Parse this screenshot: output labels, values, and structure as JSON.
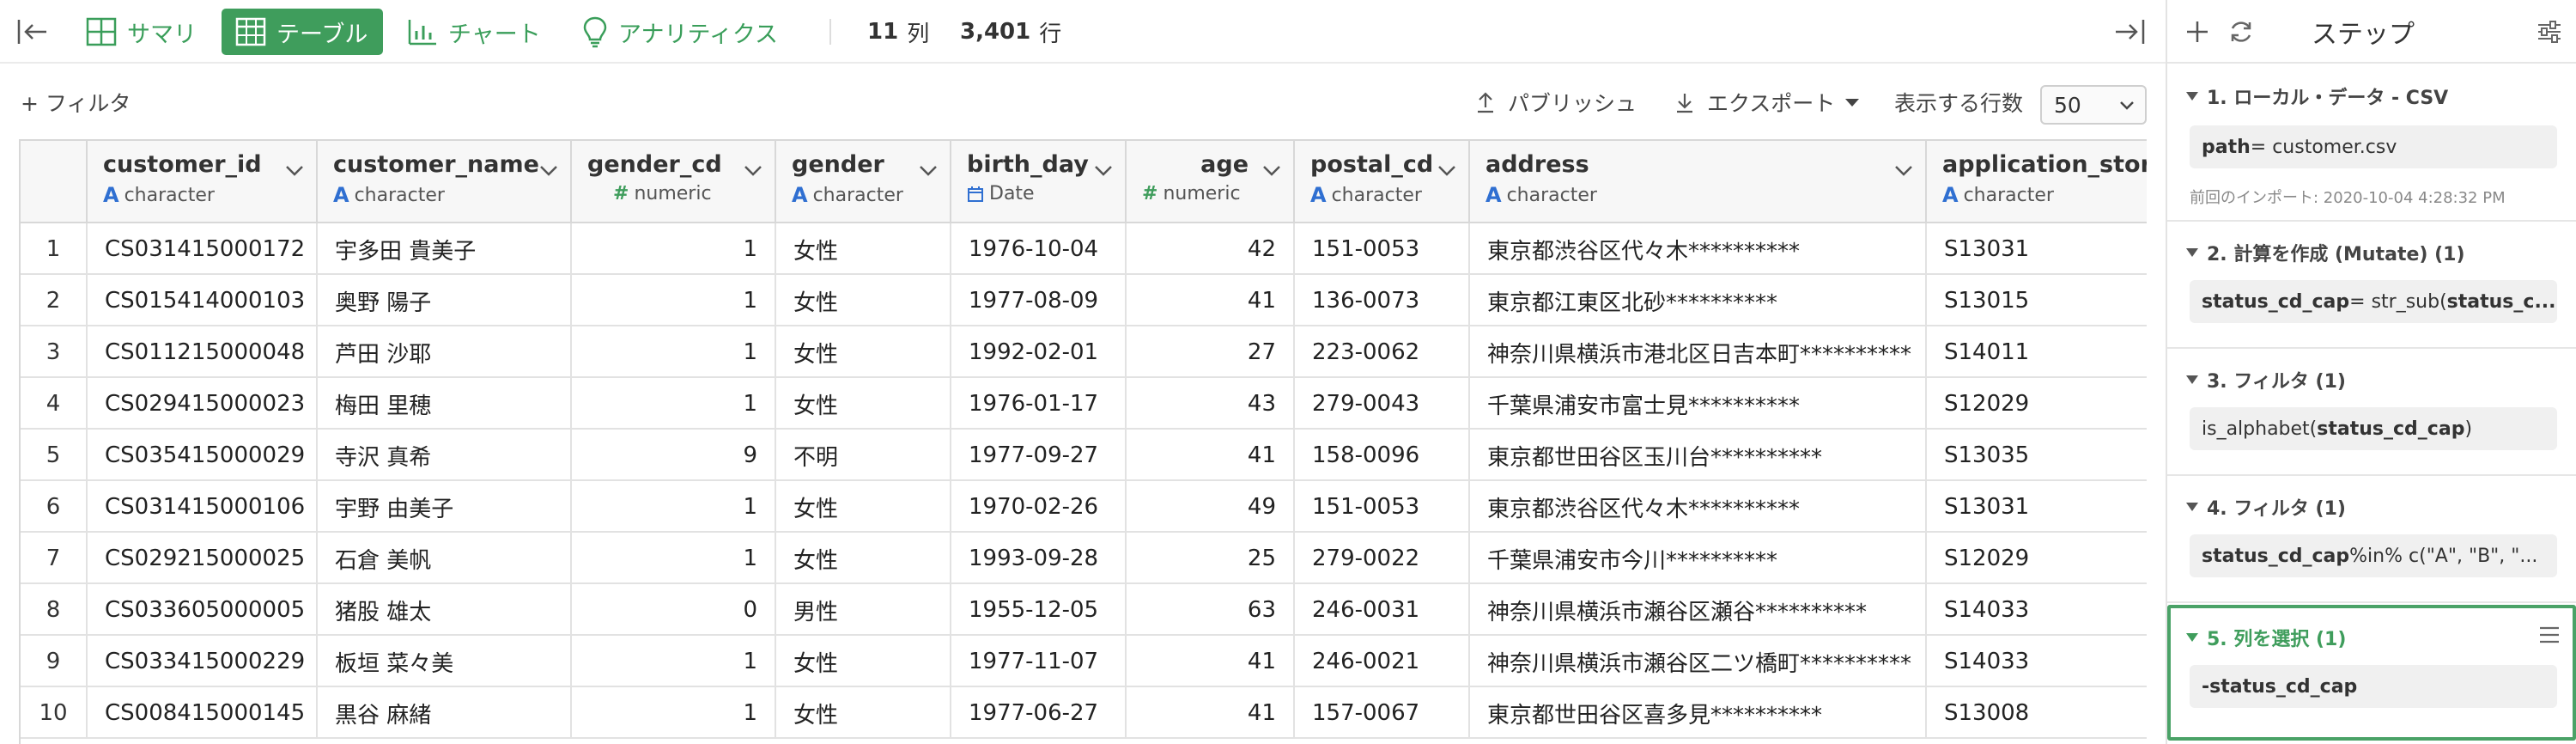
{
  "toolbar": {
    "views": [
      {
        "label": "サマリ",
        "icon": "summary-grid-icon"
      },
      {
        "label": "テーブル",
        "icon": "table-icon",
        "active": true
      },
      {
        "label": "チャート",
        "icon": "bar-chart-icon"
      },
      {
        "label": "アナリティクス",
        "icon": "lightbulb-icon"
      }
    ],
    "columns_count": "11",
    "columns_unit": "列",
    "rows_count": "3,401",
    "rows_unit": "行"
  },
  "filterbar": {
    "filter_label": "+ フィルタ",
    "publish_label": "パブリッシュ",
    "export_label": "エクスポート",
    "rows_label": "表示する行数",
    "rows_value": "50"
  },
  "table": {
    "columns": [
      {
        "name": "customer_id",
        "type": "character",
        "kind": "A"
      },
      {
        "name": "customer_name",
        "type": "character",
        "kind": "A"
      },
      {
        "name": "gender_cd",
        "type": "numeric",
        "kind": "#"
      },
      {
        "name": "gender",
        "type": "character",
        "kind": "A"
      },
      {
        "name": "birth_day",
        "type": "Date",
        "kind": "date"
      },
      {
        "name": "age",
        "type": "numeric",
        "kind": "#"
      },
      {
        "name": "postal_cd",
        "type": "character",
        "kind": "A"
      },
      {
        "name": "address",
        "type": "character",
        "kind": "A"
      },
      {
        "name": "application_store_c",
        "type": "character",
        "kind": "A"
      }
    ],
    "rows": [
      [
        "1",
        "CS031415000172",
        "宇多田 貴美子",
        "1",
        "女性",
        "1976-10-04",
        "42",
        "151-0053",
        "東京都渋谷区代々木**********",
        "S13031"
      ],
      [
        "2",
        "CS015414000103",
        "奥野 陽子",
        "1",
        "女性",
        "1977-08-09",
        "41",
        "136-0073",
        "東京都江東区北砂**********",
        "S13015"
      ],
      [
        "3",
        "CS011215000048",
        "芦田 沙耶",
        "1",
        "女性",
        "1992-02-01",
        "27",
        "223-0062",
        "神奈川県横浜市港北区日吉本町**********",
        "S14011"
      ],
      [
        "4",
        "CS029415000023",
        "梅田 里穂",
        "1",
        "女性",
        "1976-01-17",
        "43",
        "279-0043",
        "千葉県浦安市富士見**********",
        "S12029"
      ],
      [
        "5",
        "CS035415000029",
        "寺沢 真希",
        "9",
        "不明",
        "1977-09-27",
        "41",
        "158-0096",
        "東京都世田谷区玉川台**********",
        "S13035"
      ],
      [
        "6",
        "CS031415000106",
        "宇野 由美子",
        "1",
        "女性",
        "1970-02-26",
        "49",
        "151-0053",
        "東京都渋谷区代々木**********",
        "S13031"
      ],
      [
        "7",
        "CS029215000025",
        "石倉 美帆",
        "1",
        "女性",
        "1993-09-28",
        "25",
        "279-0022",
        "千葉県浦安市今川**********",
        "S12029"
      ],
      [
        "8",
        "CS033605000005",
        "猪股 雄太",
        "0",
        "男性",
        "1955-12-05",
        "63",
        "246-0031",
        "神奈川県横浜市瀬谷区瀬谷**********",
        "S14033"
      ],
      [
        "9",
        "CS033415000229",
        "板垣 菜々美",
        "1",
        "女性",
        "1977-11-07",
        "41",
        "246-0021",
        "神奈川県横浜市瀬谷区二ツ橋町**********",
        "S14033"
      ],
      [
        "10",
        "CS008415000145",
        "黒谷 麻緒",
        "1",
        "女性",
        "1977-06-27",
        "41",
        "157-0067",
        "東京都世田谷区喜多見**********",
        "S13008"
      ]
    ]
  },
  "steps": {
    "title": "ステップ",
    "items": [
      {
        "title": "1. ローカル・データ - CSV",
        "box_pre": "",
        "box_bold": "path",
        "box_post": " = customer.csv",
        "note": "前回のインポート: 2020-10-04 4:28:32 PM"
      },
      {
        "title": "2. 計算を作成 (Mutate) (1)",
        "box_pre": "",
        "box_bold": "status_cd_cap",
        "box_post": " = str_sub(",
        "box_bold2": "status_c...",
        "note": ""
      },
      {
        "title": "3. フィルタ (1)",
        "box_pre": "is_alphabet(",
        "box_bold": "status_cd_cap",
        "box_post": ")",
        "note": ""
      },
      {
        "title": "4. フィルタ (1)",
        "box_pre": "",
        "box_bold": "status_cd_cap",
        "box_post": " %in% c(\"A\", \"B\", \"...",
        "note": ""
      },
      {
        "title": "5. 列を選択 (1)",
        "box_pre": "",
        "box_bold": "-status_cd_cap",
        "box_post": "",
        "note": ""
      }
    ]
  },
  "colors": {
    "accent": "#3f9d5c",
    "type_character": "#2f6fd1",
    "selected_step_border": "#4aa267"
  }
}
